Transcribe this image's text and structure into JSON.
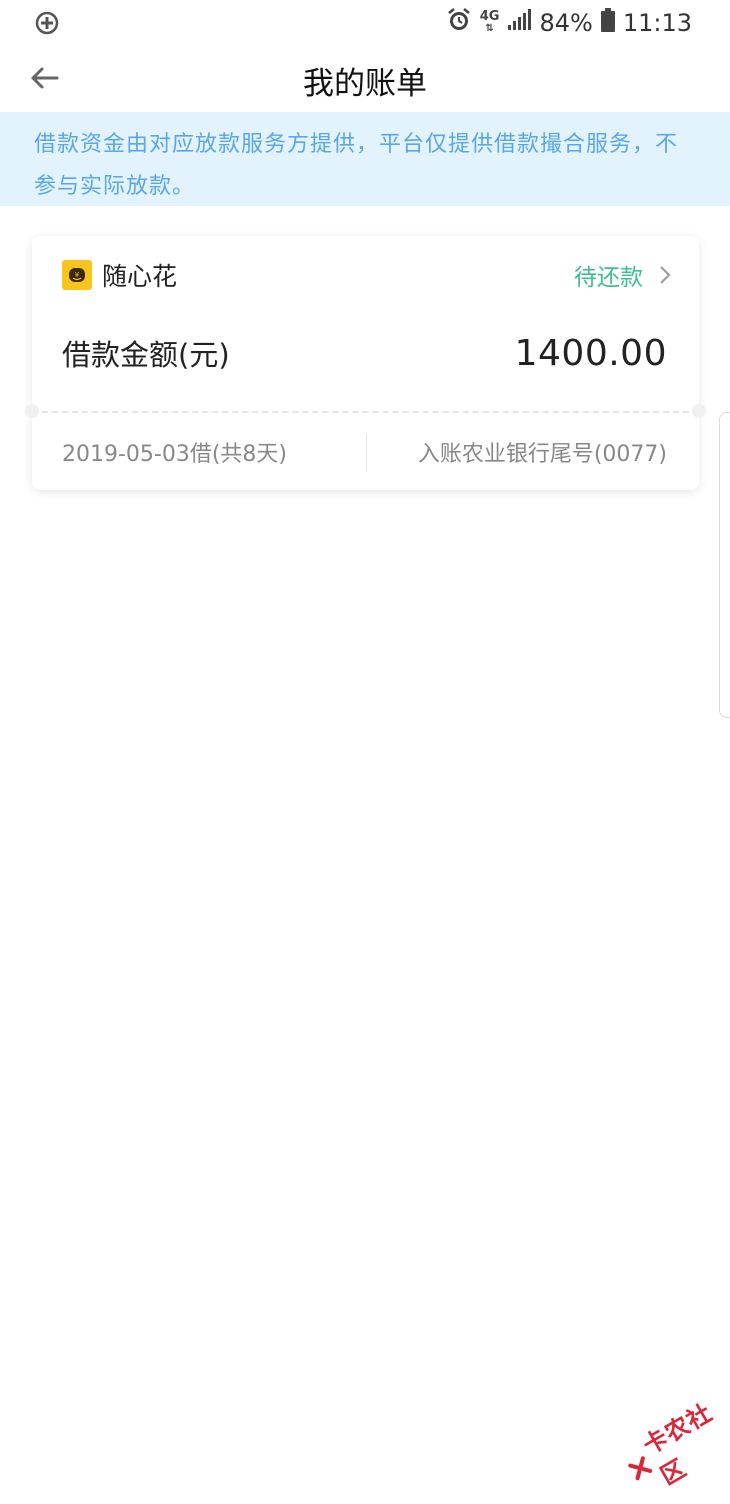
{
  "status_bar": {
    "network": "4G",
    "battery": "84%",
    "time": "11:13"
  },
  "nav": {
    "title": "我的账单"
  },
  "notice": {
    "text": "借款资金由对应放款服务方提供，平台仅提供借款撮合服务，不参与实际放款。"
  },
  "loan_card": {
    "product_name": "随心花",
    "status": "待还款",
    "amount_label": "借款金额(元)",
    "amount_value": "1400.00",
    "loan_date": "2019-05-03借(共8天)",
    "bank_info": "入账农业银行尾号(0077)"
  },
  "watermark": {
    "text": "卡农社区"
  },
  "colors": {
    "notice_bg": "#e3f3fd",
    "notice_text": "#5aa6e6",
    "status_green": "#3dbf8f",
    "logo_yellow": "#f7c51c",
    "watermark_red": "#d8283a"
  }
}
